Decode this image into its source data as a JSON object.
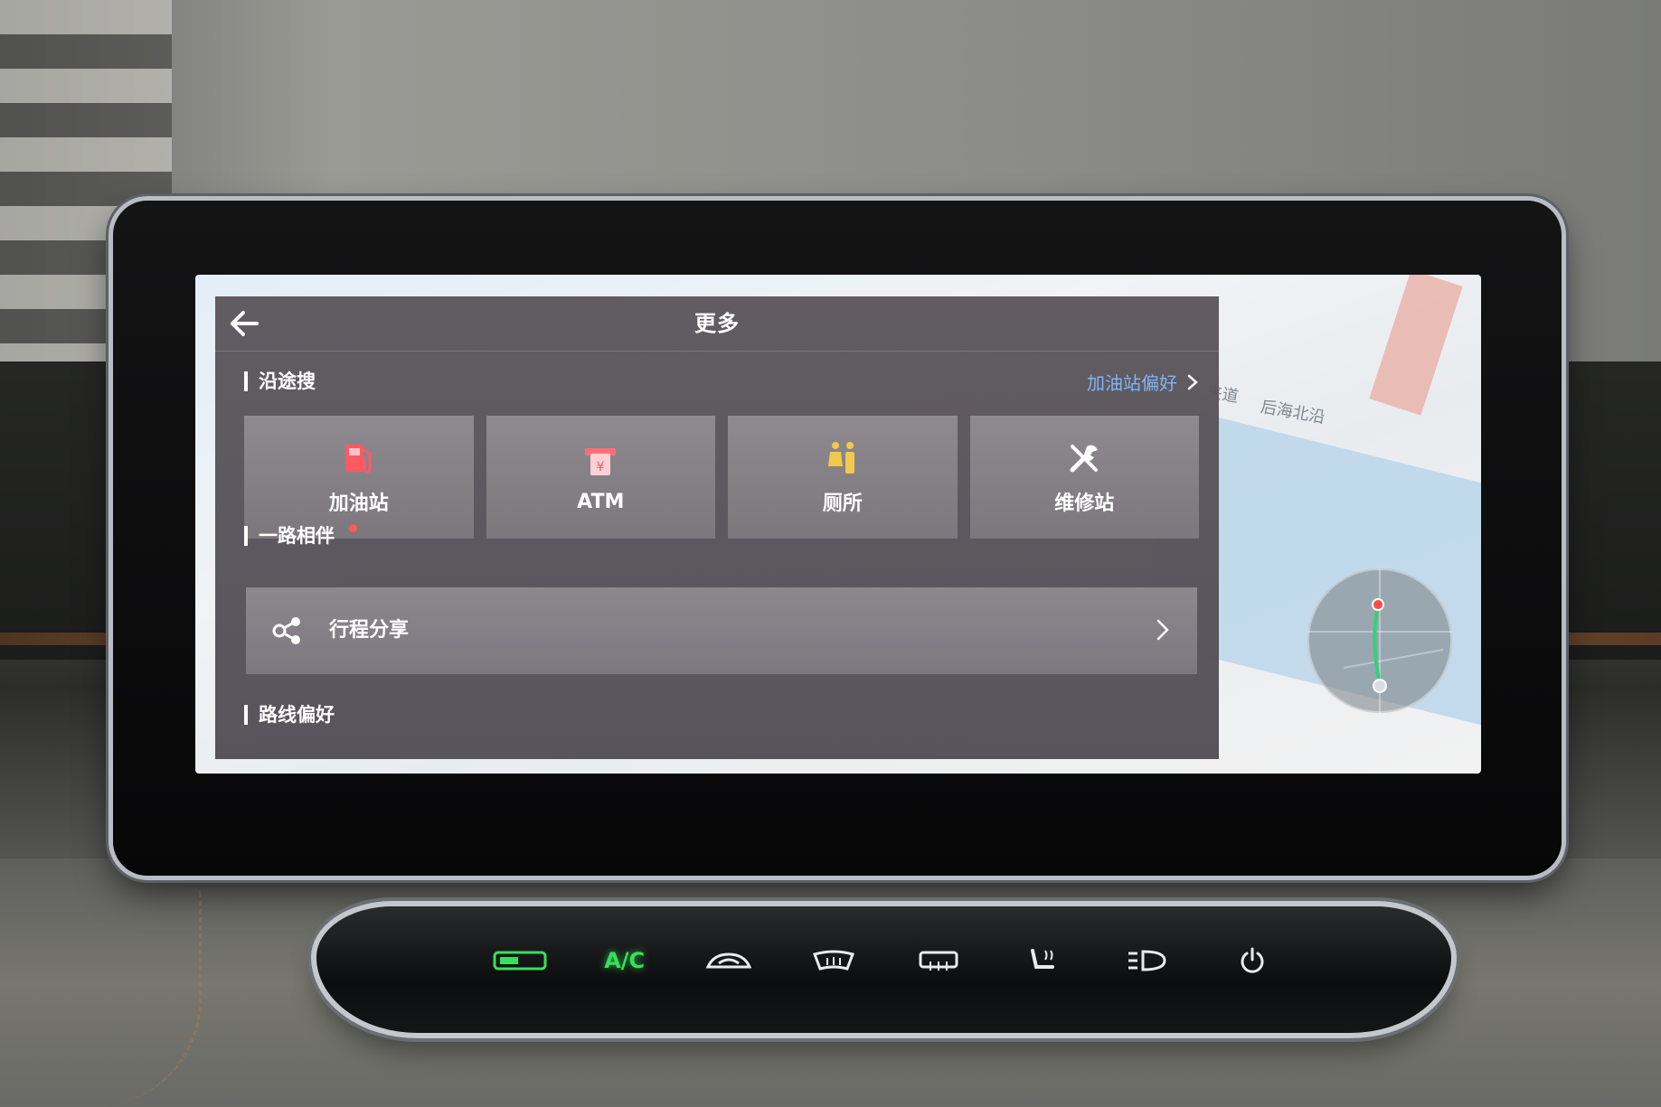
{
  "panel": {
    "title": "更多",
    "section_along_route": "沿途搜",
    "gas_pref_link": "加油站偏好",
    "tiles": [
      {
        "label": "加油站",
        "icon": "gas-station-icon"
      },
      {
        "label": "ATM",
        "icon": "atm-icon"
      },
      {
        "label": "厕所",
        "icon": "toilet-icon"
      },
      {
        "label": "维修站",
        "icon": "repair-tools-icon"
      }
    ],
    "section_companion": "一路相伴",
    "share_trip": "行程分享",
    "section_route_pref": "路线偏好"
  },
  "map": {
    "labels": [
      "夹道",
      "后海北沿"
    ]
  },
  "climate": {
    "ac_label": "A/C"
  },
  "colors": {
    "accent_link": "#7fb4f5",
    "gas_icon": "#ff5a63",
    "toilet_icon": "#f2c94c",
    "climate_green": "#37e05a"
  }
}
